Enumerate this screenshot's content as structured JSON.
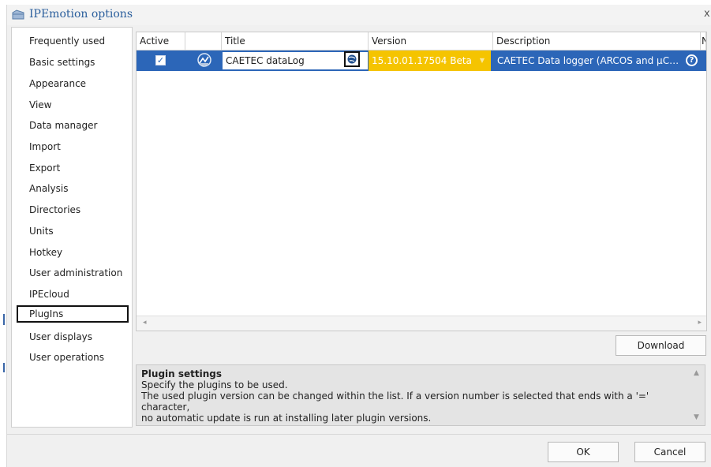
{
  "window": {
    "title": "IPEmotion options",
    "close_label": "x"
  },
  "sidebar": {
    "items": [
      {
        "label": "Frequently used"
      },
      {
        "label": "Basic settings"
      },
      {
        "label": "Appearance"
      },
      {
        "label": "View"
      },
      {
        "label": "Data manager"
      },
      {
        "label": "Import"
      },
      {
        "label": "Export"
      },
      {
        "label": "Analysis"
      },
      {
        "label": "Directories"
      },
      {
        "label": "Units"
      },
      {
        "label": "Hotkey"
      },
      {
        "label": "User administration"
      },
      {
        "label": "IPEcloud"
      },
      {
        "label": "PlugIns"
      },
      {
        "label": "User displays"
      },
      {
        "label": "User operations"
      }
    ],
    "selected": "PlugIns"
  },
  "grid": {
    "columns": [
      "Active",
      "",
      "Title",
      "Version",
      "Description",
      "N"
    ],
    "rows": [
      {
        "active": true,
        "title": "CAETEC dataLog",
        "version": "15.10.01.17504 Beta",
        "description": "CAETEC Data logger (ARCOS and μC…"
      }
    ]
  },
  "download_label": "Download",
  "info": {
    "title": "Plugin settings",
    "line1": "Specify the plugins to be used.",
    "line2": "The used plugin version can be changed within the list. If a version number is selected that ends with a '=' character,",
    "line3": "no automatic update is run at installing later plugin versions."
  },
  "buttons": {
    "ok": "OK",
    "cancel": "Cancel"
  },
  "colors": {
    "selection": "#2c66b8",
    "version_highlight": "#f5c400",
    "title": "#2a5e9c"
  }
}
